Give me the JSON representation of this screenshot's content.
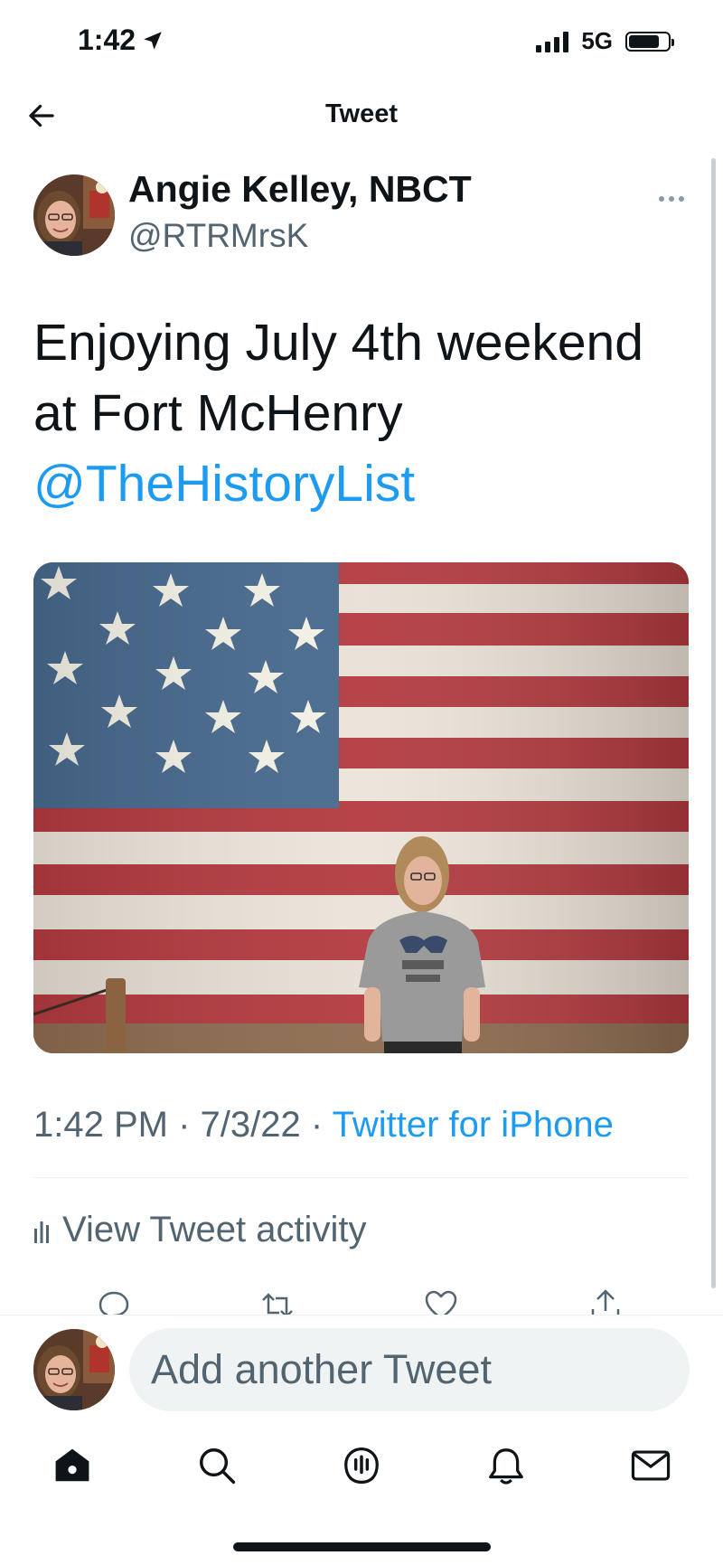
{
  "status_bar": {
    "time": "1:42",
    "network": "5G"
  },
  "header": {
    "title": "Tweet"
  },
  "tweet": {
    "author_name": "Angie Kelley, NBCT",
    "author_handle": "@RTRMrsK",
    "text_line1": "Enjoying July 4th weekend",
    "text_line2": "at Fort McHenry",
    "mention": "@TheHistoryList",
    "time": "1:42 PM",
    "date": "7/3/22",
    "separator": "·",
    "source": "Twitter for iPhone",
    "activity_label": "View Tweet activity"
  },
  "composer": {
    "placeholder": "Add another Tweet"
  },
  "colors": {
    "accent": "#1d9bf0",
    "secondary_text": "#536471",
    "primary_text": "#0f1419",
    "input_bg": "#eff3f4"
  },
  "icons": {
    "header": [
      "back-arrow-icon"
    ],
    "actions": [
      "reply-icon",
      "retweet-icon",
      "like-icon",
      "share-icon"
    ],
    "tabs": [
      "home-icon",
      "search-icon",
      "spaces-icon",
      "notifications-icon",
      "messages-icon"
    ]
  }
}
